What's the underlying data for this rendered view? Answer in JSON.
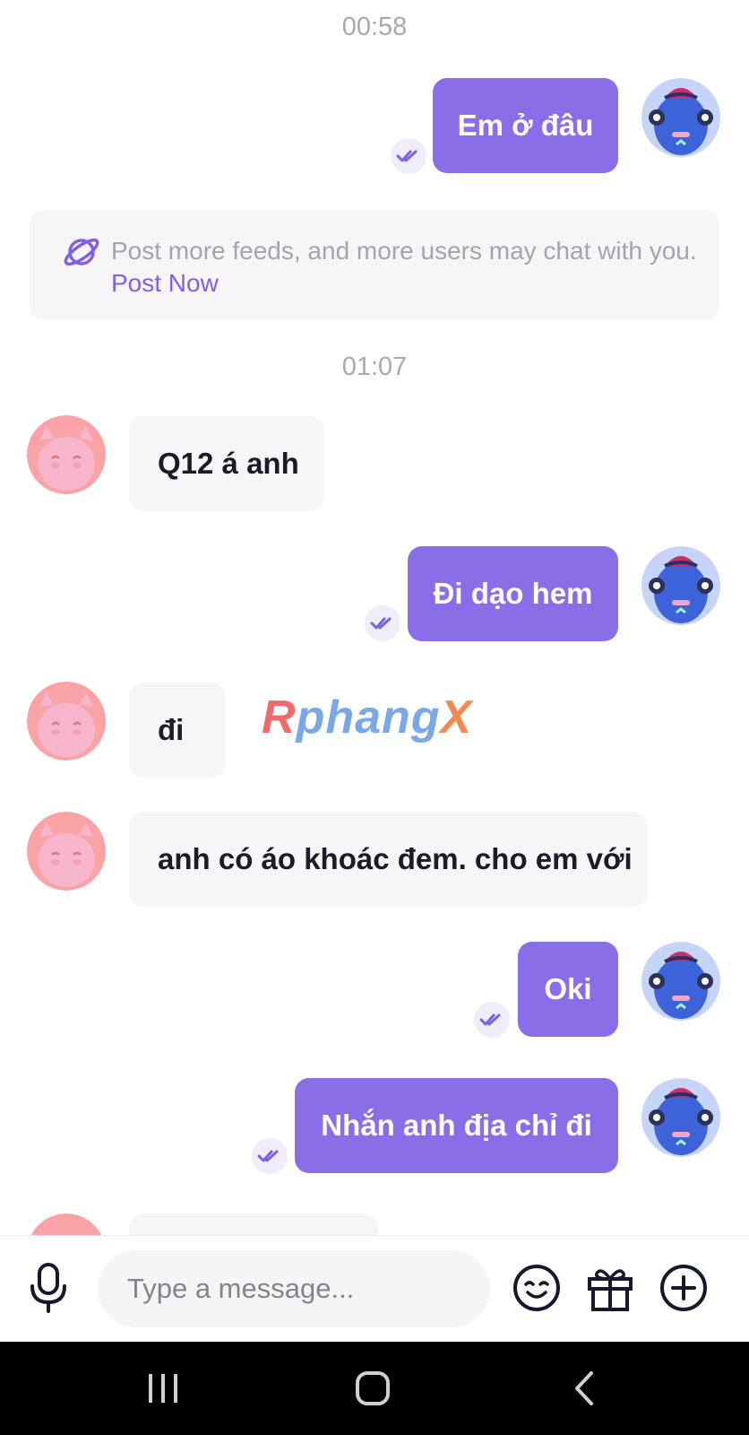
{
  "messages": {
    "time_1": "00:58",
    "time_2": "01:07",
    "out_1": "Em ở đâu",
    "in_1": "Q12 á anh",
    "out_2": "Đi dạo hem",
    "in_2": "đi",
    "in_3": "anh có áo khoác đem. cho em với",
    "out_3": "Oki",
    "out_4": "Nhắn anh địa chỉ đi"
  },
  "notice": {
    "text": "Post more feeds, and more users may chat with you. ",
    "link": "Post Now"
  },
  "watermark": {
    "first": "R",
    "middle": "phang",
    "last": "X"
  },
  "composer": {
    "placeholder": "Type a message..."
  },
  "icons": {
    "mic": "microphone-icon",
    "emoji": "emoji-icon",
    "gift": "gift-icon",
    "add": "add-circle-icon",
    "read": "double-check-icon",
    "planet": "planet-icon"
  },
  "colors": {
    "accent": "#8a6ee8",
    "incoming_bubble": "#f5f6f8",
    "navbar": "#000000"
  }
}
